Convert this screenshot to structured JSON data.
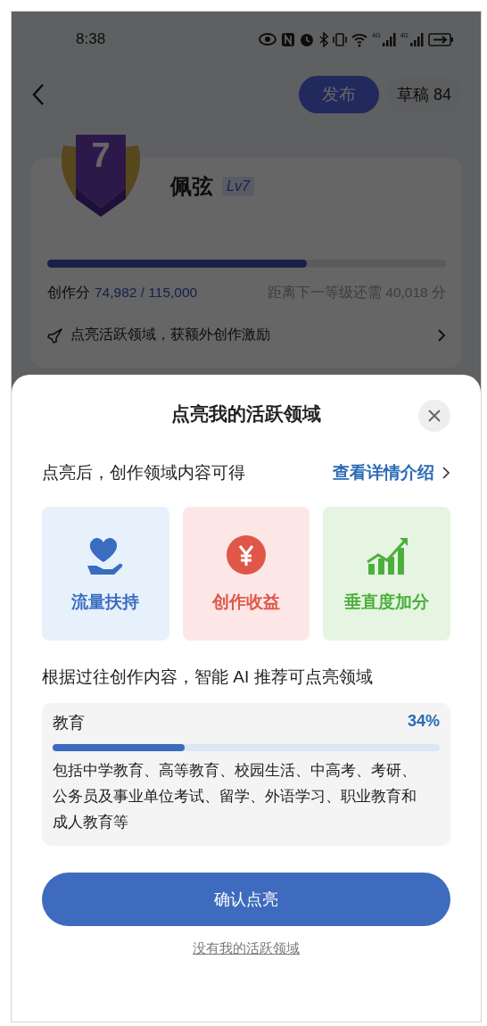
{
  "status_bar": {
    "time": "8:38",
    "network_labels": [
      "4G",
      "4G"
    ]
  },
  "header": {
    "publish_button": "发布",
    "drafts_button": "草稿 84"
  },
  "level_card": {
    "badge_number": "7",
    "username": "佩弦",
    "level_tag": "Lv7",
    "level": 0.65,
    "score_label": "创作分",
    "score_value": "74,982 / 115,000",
    "next_level_note": "距离下一等级还需 40,018 分",
    "promo_link": "点亮活跃领域，获额外创作激励"
  },
  "sheet": {
    "title": "点亮我的活跃领域",
    "subtitle": "点亮后，创作领域内容可得",
    "details_link": "查看详情介绍",
    "benefits": [
      {
        "kind": "traffic",
        "label": "流量扶持",
        "color": "#3a6cc0"
      },
      {
        "kind": "income",
        "label": "创作收益",
        "color": "#e0574a"
      },
      {
        "kind": "vertical",
        "label": "垂直度加分",
        "color": "#4caf3c"
      }
    ],
    "recommend_heading": "根据过往创作内容，智能 AI 推荐可点亮领域",
    "domains": [
      {
        "name": "教育",
        "percent": "34%",
        "level": 0.34,
        "description": "包括中学教育、高等教育、校园生活、中高考、考研、公务员及事业单位考试、留学、外语学习、职业教育和成人教育等"
      }
    ],
    "confirm_button": "确认点亮",
    "decline_link": "没有我的活跃领域"
  }
}
